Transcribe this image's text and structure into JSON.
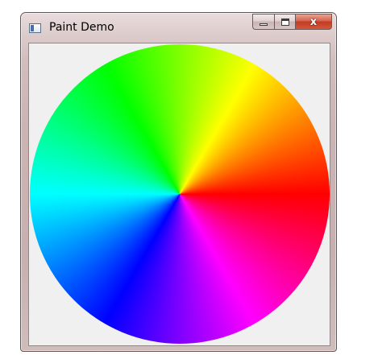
{
  "window": {
    "title": "Paint Demo"
  },
  "caption_buttons": {
    "minimize_icon": "minimize-icon",
    "maximize_icon": "maximize-icon",
    "close_glyph": "x",
    "close_color": "#c13c24"
  },
  "canvas": {
    "content": "color-wheel",
    "background": "#f0f0f0",
    "hue_stops": [
      "#ff0000",
      "#ff00ff",
      "#0000ff",
      "#00ffff",
      "#00ff00",
      "#ffff00"
    ]
  }
}
